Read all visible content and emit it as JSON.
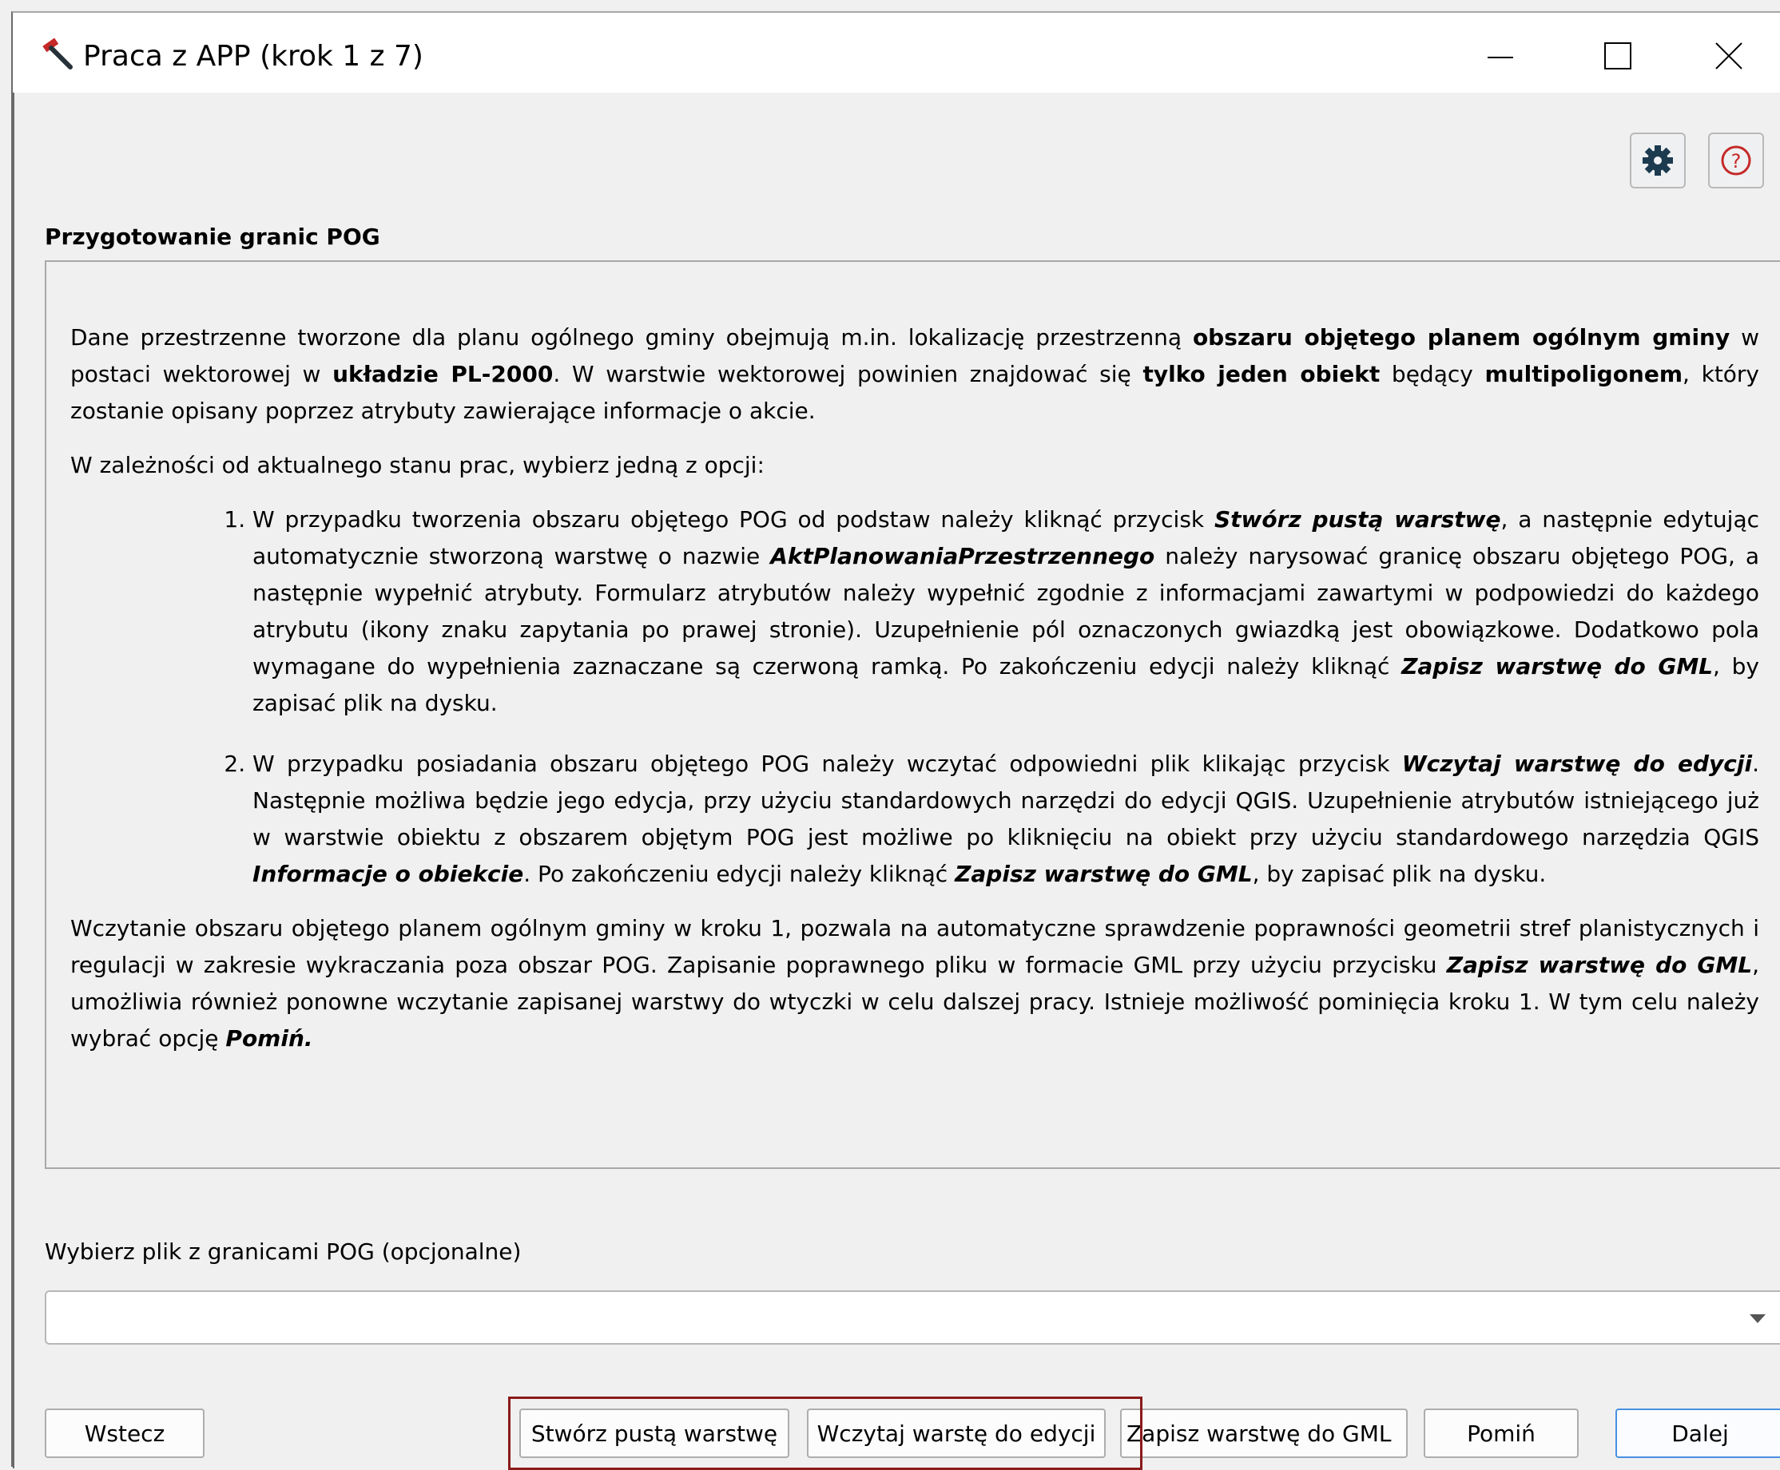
{
  "window": {
    "title": "Praca z APP (krok 1 z 7)",
    "icon": "hammer-icon"
  },
  "toolbar": {
    "settings_icon": "gear-icon",
    "help_icon": "help-icon",
    "help_glyph": "?"
  },
  "section": {
    "title": "Przygotowanie granic POG"
  },
  "info": {
    "p1": [
      {
        "t": "Dane przestrzenne tworzone dla planu ogólnego gminy obejmują m.in. lokalizację przestrzenną "
      },
      {
        "t": "obszaru objętego planem ogólnym gminy",
        "b": true
      },
      {
        "t": " w postaci wektorowej w "
      },
      {
        "t": "układzie PL-2000",
        "b": true
      },
      {
        "t": ". W warstwie wektorowej powinien znajdować się "
      },
      {
        "t": "tylko jeden obiekt",
        "b": true
      },
      {
        "t": " będący "
      },
      {
        "t": "multipoligonem",
        "b": true
      },
      {
        "t": ", który zostanie opisany poprzez atrybuty zawierające informacje o akcie."
      }
    ],
    "p2": [
      {
        "t": "W zależności od aktualnego stanu prac, wybierz jedną z opcji:"
      }
    ],
    "item1": [
      {
        "t": "W przypadku tworzenia obszaru objętego POG od podstaw należy kliknąć przycisk "
      },
      {
        "t": "Stwórz pustą warstwę",
        "b": true,
        "i": true
      },
      {
        "t": ", a następnie edytując automatycznie stworzoną warstwę o nazwie "
      },
      {
        "t": "AktPlanowaniaPrzestrzennego",
        "b": true,
        "i": true
      },
      {
        "t": " należy narysować granicę obszaru objętego POG, a następnie wypełnić atrybuty. Formularz atrybutów należy wypełnić zgodnie z informacjami zawartymi w podpowiedzi do każdego atrybutu (ikony znaku zapytania po prawej stronie).  Uzupełnienie pól oznaczonych gwiazdką jest obowiązkowe. Dodatkowo pola wymagane do wypełnienia zaznaczane są czerwoną ramką. Po zakończeniu edycji należy kliknąć "
      },
      {
        "t": "Zapisz warstwę do GML",
        "b": true,
        "i": true
      },
      {
        "t": ", by zapisać plik na dysku."
      }
    ],
    "item2": [
      {
        "t": "W przypadku posiadania obszaru objętego POG należy wczytać odpowiedni plik klikając przycisk "
      },
      {
        "t": "Wczytaj warstwę do edycji",
        "b": true,
        "i": true
      },
      {
        "t": ". Następnie możliwa będzie jego edycja, przy użyciu standardowych narzędzi do edycji QGIS. Uzupełnienie atrybutów istniejącego już w warstwie obiektu z obszarem objętym POG jest możliwe po kliknięciu na obiekt przy użyciu standardowego narzędzia QGIS "
      },
      {
        "t": "Informacje o obiekcie",
        "b": true,
        "i": true
      },
      {
        "t": ". Po zakończeniu edycji należy kliknąć "
      },
      {
        "t": "Zapisz warstwę do GML",
        "b": true,
        "i": true
      },
      {
        "t": ", by zapisać plik na dysku."
      }
    ],
    "p3": [
      {
        "t": "Wczytanie obszaru objętego planem ogólnym gminy w kroku 1, pozwala na automatyczne sprawdzenie poprawności geometrii stref planistycznych i regulacji w zakresie wykraczania poza obszar POG. Zapisanie poprawnego pliku w formacie GML przy użyciu przycisku "
      },
      {
        "t": "Zapisz warstwę do GML",
        "b": true,
        "i": true
      },
      {
        "t": ", umożliwia również ponowne wczytanie zapisanej warstwy do wtyczki w celu dalszej pracy. Istnieje możliwość pominięcia kroku 1. W tym celu należy wybrać opcję "
      },
      {
        "t": "Pomiń.",
        "b": true,
        "i": true
      }
    ]
  },
  "file_select": {
    "label": "Wybierz plik z granicami POG (opcjonalne)",
    "value": ""
  },
  "buttons": {
    "back": "Wstecz",
    "create": "Stwórz pustą warstwę",
    "load": "Wczytaj warstę do edycji",
    "save": "Zapisz warstwę do GML",
    "skip": "Pomiń",
    "next": "Dalej"
  },
  "colors": {
    "highlight": "#8b1a1a",
    "accent": "#4a90e2"
  }
}
